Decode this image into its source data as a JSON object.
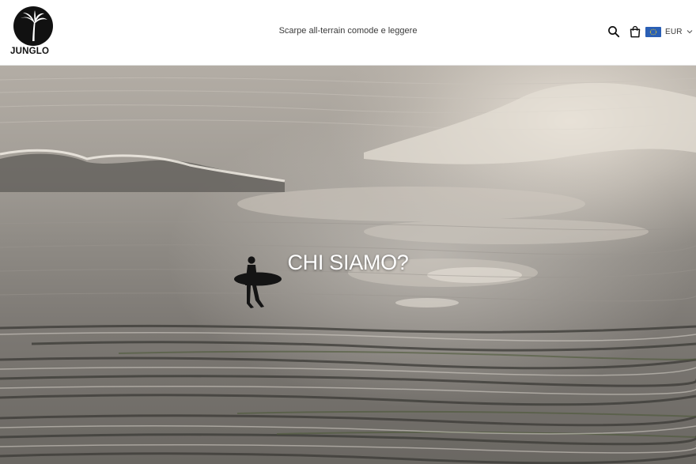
{
  "brand": {
    "name": "JUNGLO",
    "logo_icon": "palm-tree-icon"
  },
  "header": {
    "tagline": "Scarpe all-terrain comode e leggere",
    "icons": {
      "search": "search-icon",
      "cart": "shopping-bag-icon",
      "currency_flag": "eu-flag-icon",
      "dropdown": "chevron-down-icon"
    },
    "currency": {
      "selected": "EUR"
    }
  },
  "hero": {
    "title": "CHI SIAMO?"
  },
  "colors": {
    "header_bg": "#ffffff",
    "text_dark": "#111111",
    "flag_blue": "#2a5fb5",
    "hero_title": "#ffffff"
  }
}
